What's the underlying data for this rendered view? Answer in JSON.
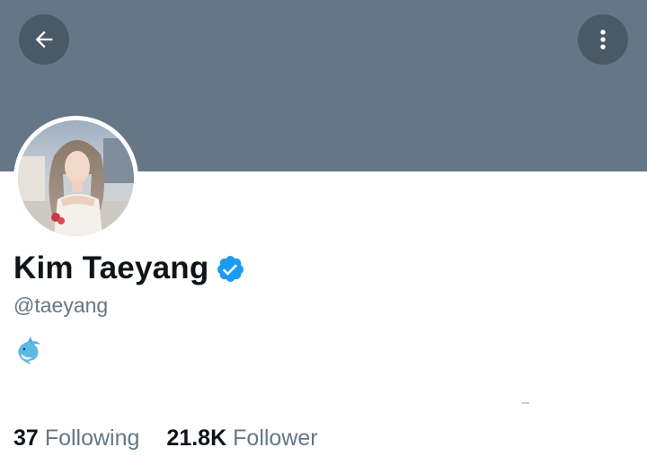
{
  "header": {
    "back_icon": "arrow-left-icon",
    "more_icon": "vertical-dots-icon"
  },
  "profile": {
    "display_name": "Kim Taeyang",
    "verified_icon": "verified-badge-icon",
    "handle": "@taeyang",
    "bio_emoji": "dolphin-emoji"
  },
  "stats": {
    "following_count": "37",
    "following_label": "Following",
    "followers_count": "21.8K",
    "followers_label": "Follower"
  },
  "colors": {
    "banner": "#657786",
    "button_bg": "#4a5966",
    "verified": "#1d9bf0",
    "text_primary": "#0f1419",
    "text_secondary": "#657786"
  }
}
